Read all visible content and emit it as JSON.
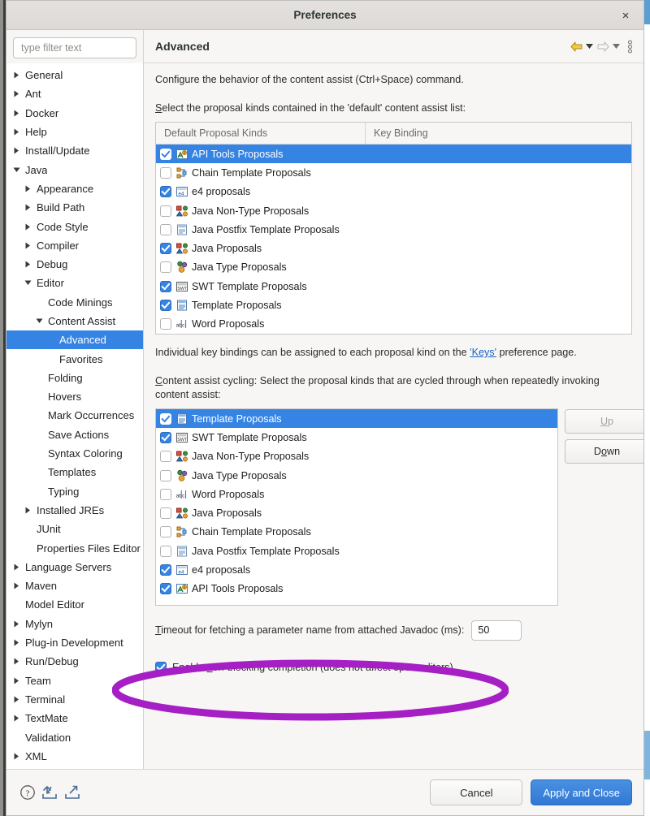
{
  "window": {
    "title": "Preferences",
    "close_label": "×"
  },
  "sidebar": {
    "filter_placeholder": "type filter text",
    "items": [
      {
        "label": "General",
        "indent": 0,
        "arrow": "right"
      },
      {
        "label": "Ant",
        "indent": 0,
        "arrow": "right"
      },
      {
        "label": "Docker",
        "indent": 0,
        "arrow": "right"
      },
      {
        "label": "Help",
        "indent": 0,
        "arrow": "right"
      },
      {
        "label": "Install/Update",
        "indent": 0,
        "arrow": "right"
      },
      {
        "label": "Java",
        "indent": 0,
        "arrow": "down"
      },
      {
        "label": "Appearance",
        "indent": 1,
        "arrow": "right"
      },
      {
        "label": "Build Path",
        "indent": 1,
        "arrow": "right"
      },
      {
        "label": "Code Style",
        "indent": 1,
        "arrow": "right"
      },
      {
        "label": "Compiler",
        "indent": 1,
        "arrow": "right"
      },
      {
        "label": "Debug",
        "indent": 1,
        "arrow": "right"
      },
      {
        "label": "Editor",
        "indent": 1,
        "arrow": "down"
      },
      {
        "label": "Code Minings",
        "indent": 2,
        "arrow": "none"
      },
      {
        "label": "Content Assist",
        "indent": 2,
        "arrow": "down"
      },
      {
        "label": "Advanced",
        "indent": 3,
        "arrow": "none",
        "selected": true
      },
      {
        "label": "Favorites",
        "indent": 3,
        "arrow": "none"
      },
      {
        "label": "Folding",
        "indent": 2,
        "arrow": "none"
      },
      {
        "label": "Hovers",
        "indent": 2,
        "arrow": "none"
      },
      {
        "label": "Mark Occurrences",
        "indent": 2,
        "arrow": "none"
      },
      {
        "label": "Save Actions",
        "indent": 2,
        "arrow": "none"
      },
      {
        "label": "Syntax Coloring",
        "indent": 2,
        "arrow": "none"
      },
      {
        "label": "Templates",
        "indent": 2,
        "arrow": "none"
      },
      {
        "label": "Typing",
        "indent": 2,
        "arrow": "none"
      },
      {
        "label": "Installed JREs",
        "indent": 1,
        "arrow": "right"
      },
      {
        "label": "JUnit",
        "indent": 1,
        "arrow": "none"
      },
      {
        "label": "Properties Files Editor",
        "indent": 1,
        "arrow": "none"
      },
      {
        "label": "Language Servers",
        "indent": 0,
        "arrow": "right"
      },
      {
        "label": "Maven",
        "indent": 0,
        "arrow": "right"
      },
      {
        "label": "Model Editor",
        "indent": 0,
        "arrow": "none"
      },
      {
        "label": "Mylyn",
        "indent": 0,
        "arrow": "right"
      },
      {
        "label": "Plug-in Development",
        "indent": 0,
        "arrow": "right"
      },
      {
        "label": "Run/Debug",
        "indent": 0,
        "arrow": "right"
      },
      {
        "label": "Team",
        "indent": 0,
        "arrow": "right"
      },
      {
        "label": "Terminal",
        "indent": 0,
        "arrow": "right"
      },
      {
        "label": "TextMate",
        "indent": 0,
        "arrow": "right"
      },
      {
        "label": "Validation",
        "indent": 0,
        "arrow": "none"
      },
      {
        "label": "XML",
        "indent": 0,
        "arrow": "right"
      }
    ]
  },
  "page": {
    "title": "Advanced",
    "description": "Configure the behavior of the content assist (Ctrl+Space) command.",
    "default_list_label_pre": "S",
    "default_list_label_post": "elect the proposal kinds contained in the 'default' content assist list:",
    "keys_note_pre": "Individual key bindings can be assigned to each proposal kind on the ",
    "keys_link": "'Keys'",
    "keys_note_post": " preference page.",
    "cycling_label_pre": "C",
    "cycling_label_post": "ontent assist cycling: Select the proposal kinds that are cycled through when repeatedly invoking content assist:",
    "timeout_label_pre": "T",
    "timeout_label_post": "imeout for fetching a parameter name from attached Javadoc (ms):",
    "timeout_value": "50",
    "nonblocking_pre": "Enable ",
    "nonblocking_mnem": "n",
    "nonblocking_post": "on-blocking completion (does not affect open editors)",
    "nonblocking_checked": true
  },
  "default_table": {
    "columns": [
      "Default Proposal Kinds",
      "Key Binding"
    ],
    "rows": [
      {
        "label": "API Tools Proposals",
        "checked": true,
        "icon": "api-tools-icon",
        "selected": true,
        "key_binding": ""
      },
      {
        "label": "Chain Template Proposals",
        "checked": false,
        "icon": "chain-template-icon",
        "key_binding": ""
      },
      {
        "label": "e4 proposals",
        "checked": true,
        "icon": "e4-icon",
        "key_binding": ""
      },
      {
        "label": "Java Non-Type Proposals",
        "checked": false,
        "icon": "java-nontype-icon",
        "key_binding": ""
      },
      {
        "label": "Java Postfix Template Proposals",
        "checked": false,
        "icon": "postfix-template-icon",
        "key_binding": ""
      },
      {
        "label": "Java Proposals",
        "checked": true,
        "icon": "java-nontype-icon",
        "key_binding": ""
      },
      {
        "label": "Java Type Proposals",
        "checked": false,
        "icon": "java-type-icon",
        "key_binding": ""
      },
      {
        "label": "SWT Template Proposals",
        "checked": true,
        "icon": "swt-template-icon",
        "key_binding": ""
      },
      {
        "label": "Template Proposals",
        "checked": true,
        "icon": "template-icon",
        "key_binding": ""
      },
      {
        "label": "Word Proposals",
        "checked": false,
        "icon": "word-proposals-icon",
        "key_binding": ""
      }
    ]
  },
  "cycling_list": {
    "rows": [
      {
        "label": "Template Proposals",
        "checked": true,
        "icon": "template-icon",
        "selected": true
      },
      {
        "label": "SWT Template Proposals",
        "checked": true,
        "icon": "swt-template-icon"
      },
      {
        "label": "Java Non-Type Proposals",
        "checked": false,
        "icon": "java-nontype-icon"
      },
      {
        "label": "Java Type Proposals",
        "checked": false,
        "icon": "java-type-icon"
      },
      {
        "label": "Word Proposals",
        "checked": false,
        "icon": "word-proposals-icon"
      },
      {
        "label": "Java Proposals",
        "checked": false,
        "icon": "java-nontype-icon"
      },
      {
        "label": "Chain Template Proposals",
        "checked": false,
        "icon": "chain-template-icon"
      },
      {
        "label": "Java Postfix Template Proposals",
        "checked": false,
        "icon": "postfix-template-icon"
      },
      {
        "label": "e4 proposals",
        "checked": true,
        "icon": "e4-icon"
      },
      {
        "label": "API Tools Proposals",
        "checked": true,
        "icon": "api-tools-icon"
      }
    ],
    "up_label": "Up",
    "up_mnem": "U",
    "down_label": "Down",
    "down_mnem": "D"
  },
  "footer": {
    "cancel_label": "Cancel",
    "apply_close_label": "Apply and Close"
  },
  "annotation": {
    "shape": "ellipse",
    "color": "#a51fc4"
  },
  "colors": {
    "selection": "#3584e4",
    "accent_button": "#3078d4",
    "link": "#1a62c4",
    "annotation": "#a51fc4"
  }
}
